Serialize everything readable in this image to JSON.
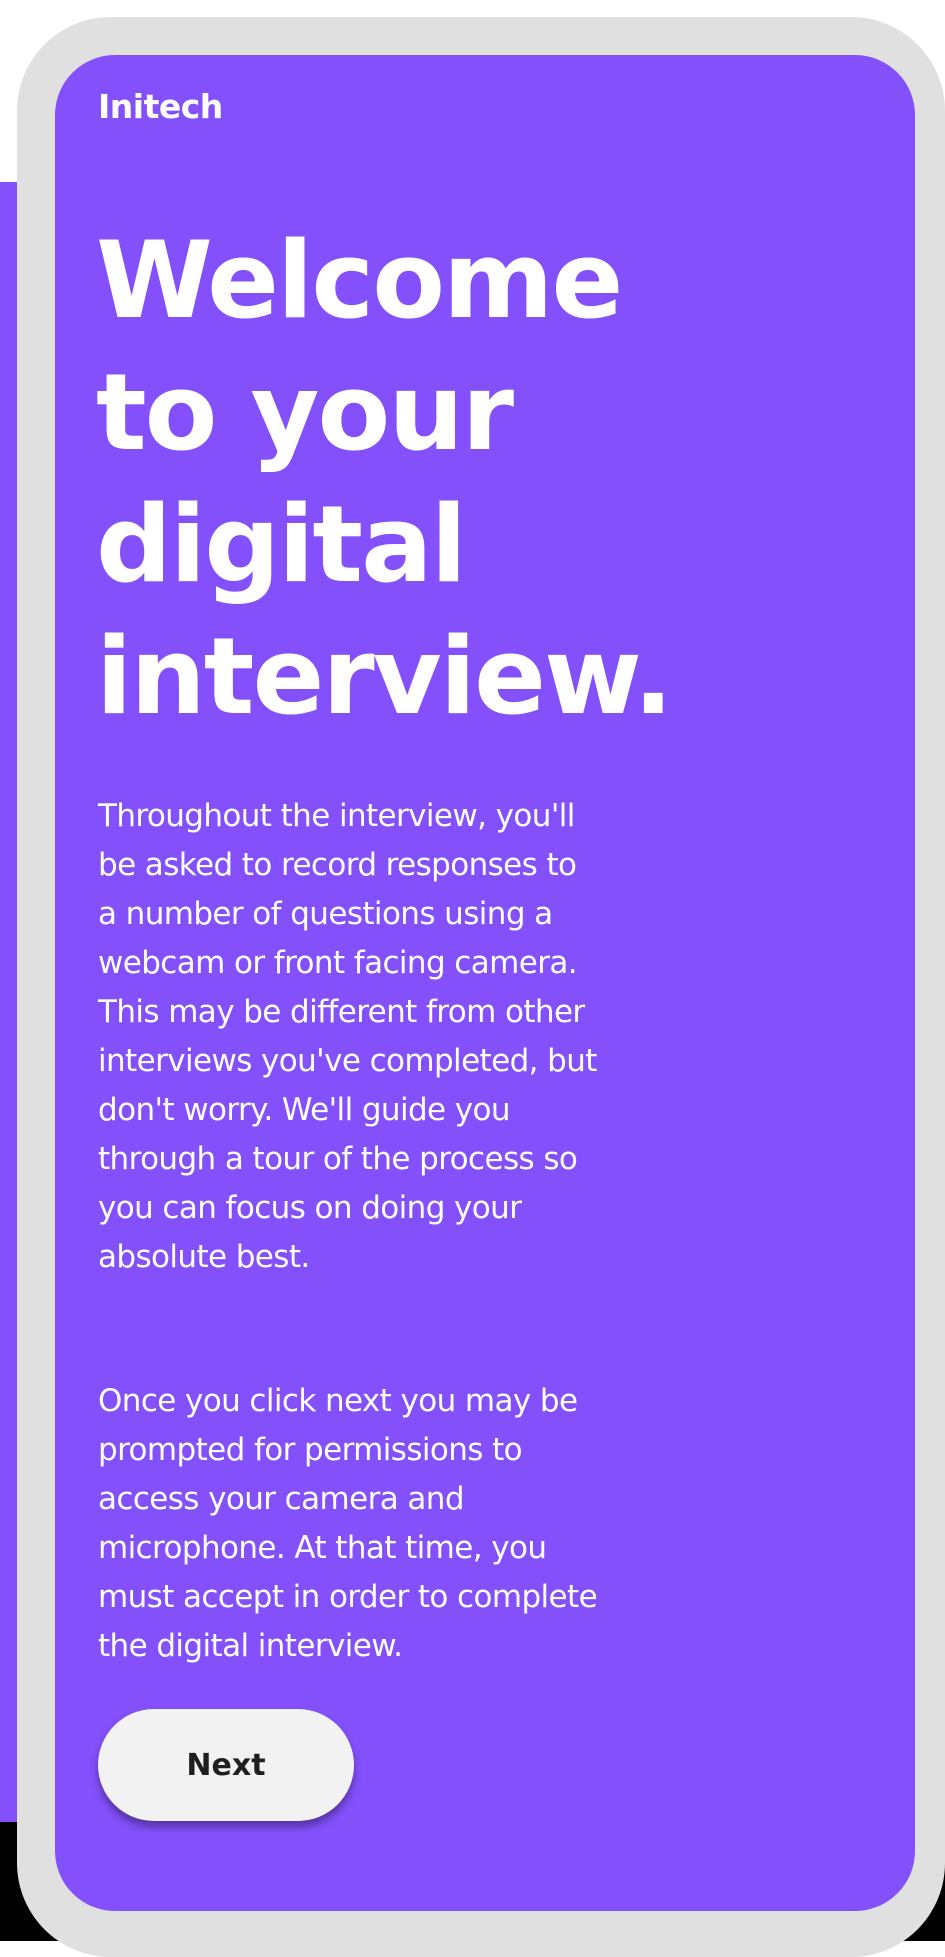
{
  "brand": {
    "name": "Initech"
  },
  "welcome": {
    "headline": "Welcome to your digital interview.",
    "paragraph_1": "Throughout the interview, you'll be asked to record responses to a number of questions using a webcam or front facing camera. This may be different from other interviews you've completed, but don't worry. We'll guide you through a tour of the process so you can focus on doing your absolute best.",
    "paragraph_2": "Once you click next you may be prompted for permissions to access your camera and microphone. At that time, you must accept in order to complete the digital interview.",
    "next_label": "Next"
  },
  "colors": {
    "accent": "#8350fb",
    "frame": "#e0e0e0",
    "button_bg": "#f2f2f2",
    "text": "#ffffff"
  }
}
